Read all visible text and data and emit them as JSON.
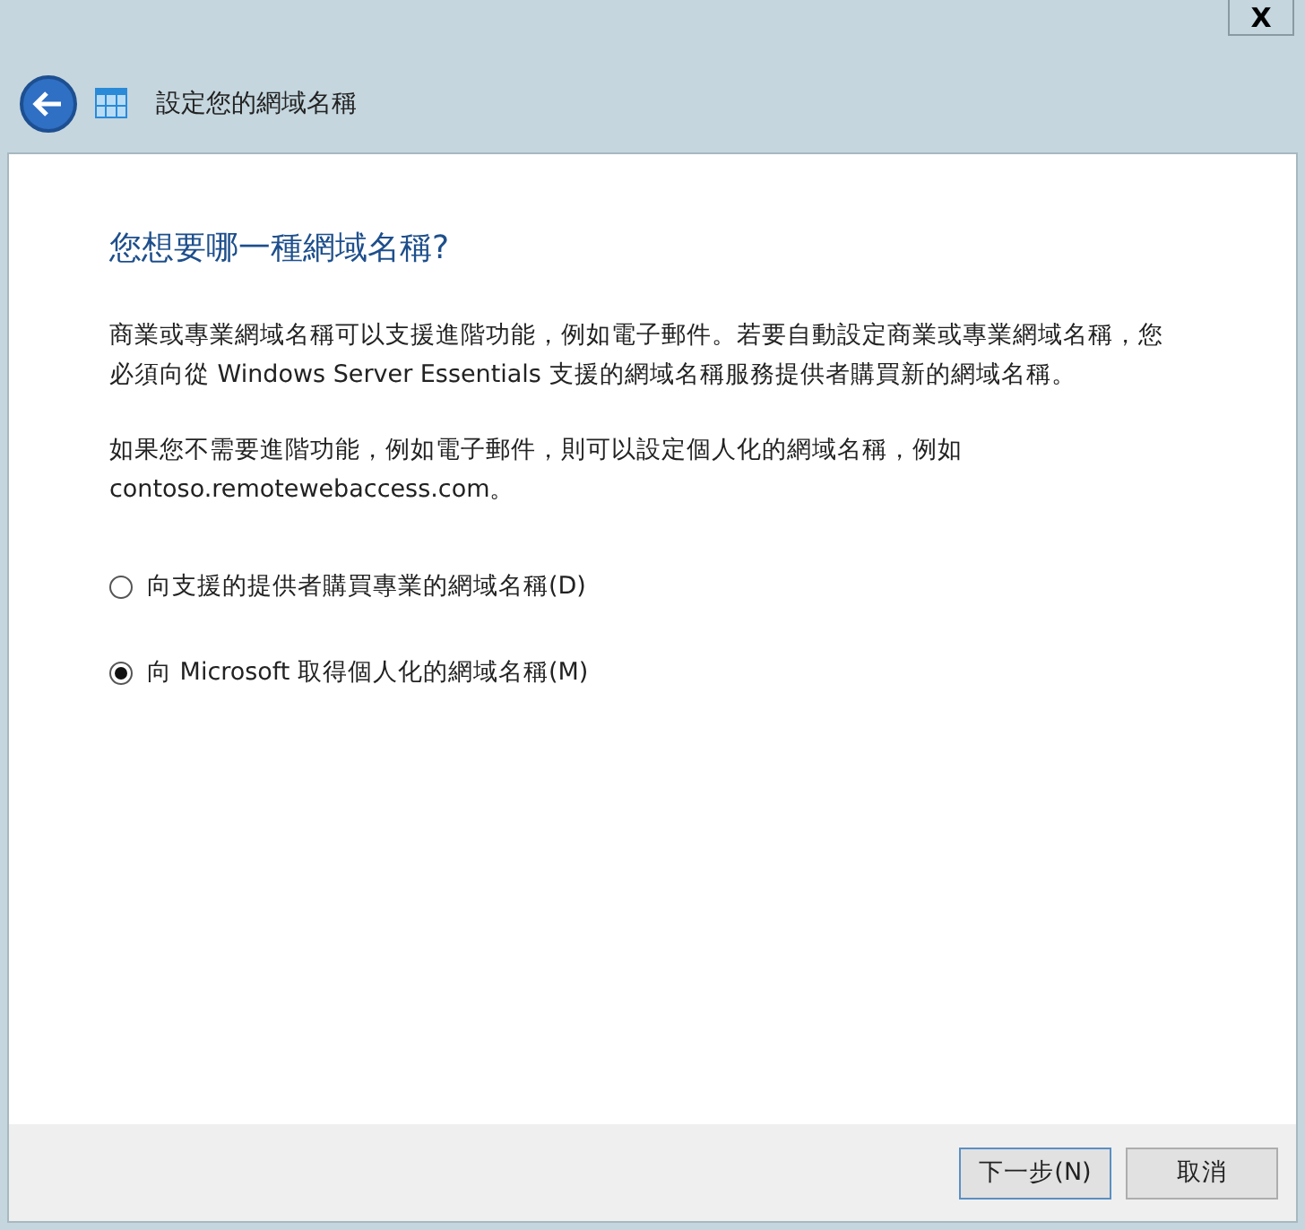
{
  "window": {
    "close": "X",
    "title": "設定您的網域名稱"
  },
  "heading": "您想要哪一種網域名稱?",
  "paragraphs": [
    "商業或專業網域名稱可以支援進階功能，例如電子郵件。若要自動設定商業或專業網域名稱，您必須向從 Windows Server Essentials 支援的網域名稱服務提供者購買新的網域名稱。",
    "如果您不需要進階功能，例如電子郵件，則可以設定個人化的網域名稱，例如 contoso.remotewebaccess.com。"
  ],
  "options": [
    {
      "label": "向支援的提供者購買專業的網域名稱(D)",
      "selected": false
    },
    {
      "label": "向 Microsoft 取得個人化的網域名稱(M)",
      "selected": true
    }
  ],
  "buttons": [
    {
      "label": "下一步(N)",
      "kind": "default"
    },
    {
      "label": "取消",
      "kind": "normal"
    }
  ]
}
